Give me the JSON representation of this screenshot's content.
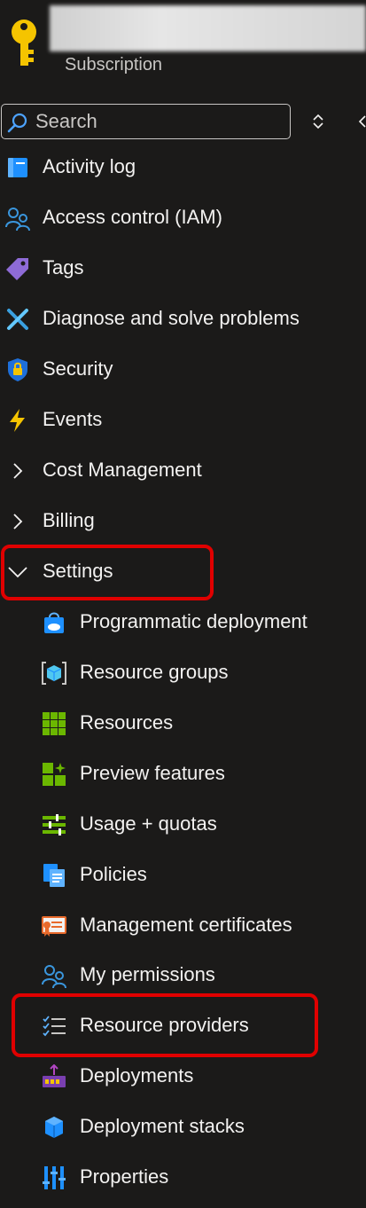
{
  "header": {
    "icon": "key-icon",
    "subtitle": "Subscription"
  },
  "search": {
    "placeholder": "Search"
  },
  "nav": {
    "activity_log": "Activity log",
    "access_control": "Access control (IAM)",
    "tags": "Tags",
    "diagnose": "Diagnose and solve problems",
    "security": "Security",
    "events": "Events",
    "cost_management": "Cost Management",
    "billing": "Billing",
    "settings": "Settings",
    "settings_children": {
      "programmatic_deployment": "Programmatic deployment",
      "resource_groups": "Resource groups",
      "resources": "Resources",
      "preview_features": "Preview features",
      "usage_quotas": "Usage + quotas",
      "policies": "Policies",
      "management_certificates": "Management certificates",
      "my_permissions": "My permissions",
      "resource_providers": "Resource providers",
      "deployments": "Deployments",
      "deployment_stacks": "Deployment stacks",
      "properties": "Properties"
    }
  },
  "highlighted_items": [
    "Settings",
    "Resource providers"
  ],
  "colors": {
    "background": "#1b1a19",
    "text": "#f3f2f1",
    "highlight": "#e00000",
    "key_yellow": "#f5c400"
  }
}
